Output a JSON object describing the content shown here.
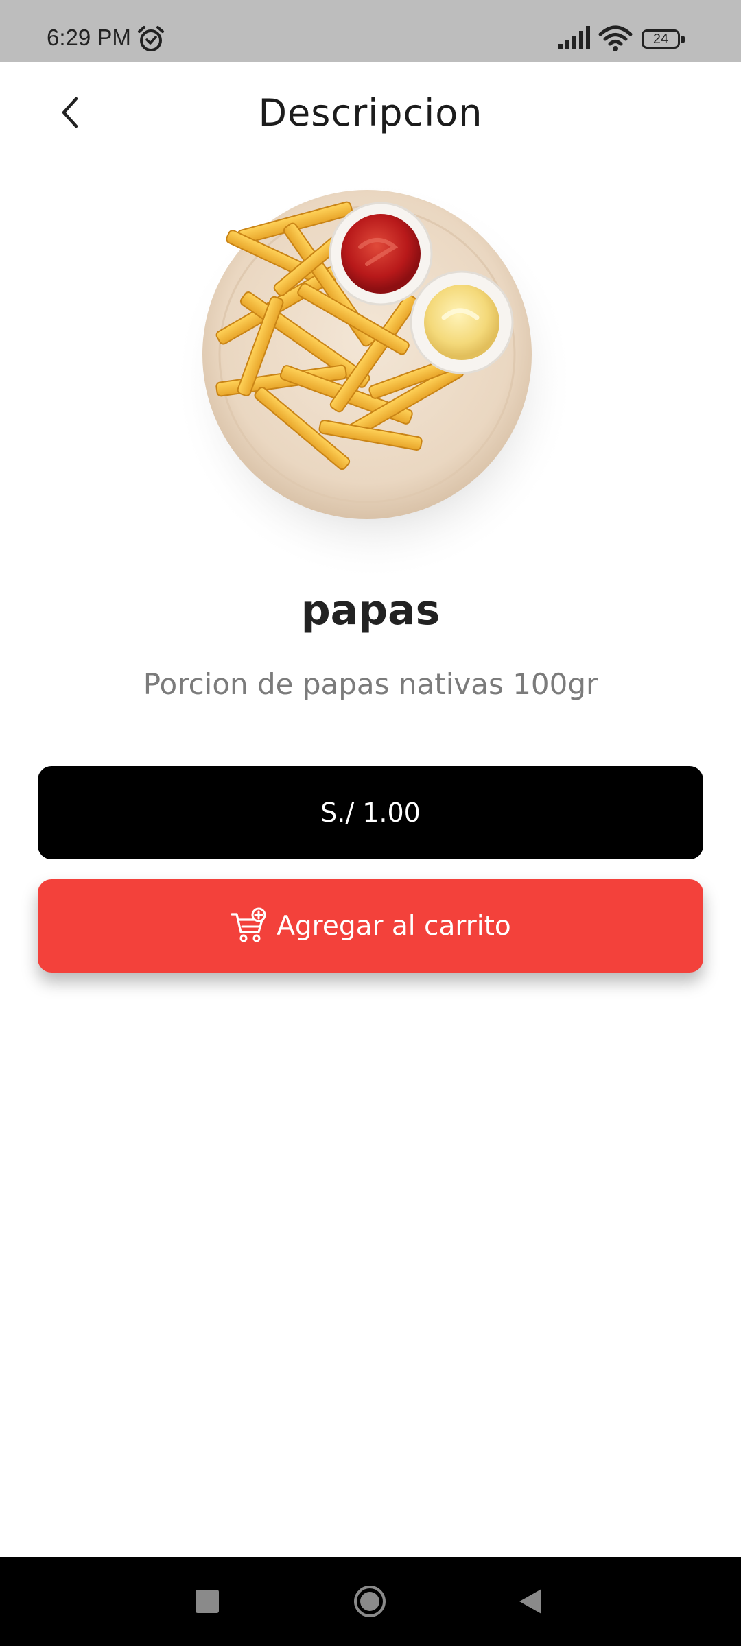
{
  "status_bar": {
    "time": "6:29 PM",
    "battery": "24",
    "icons": [
      "alarm-icon",
      "signal-icon",
      "wifi-icon",
      "battery-icon"
    ]
  },
  "header": {
    "title": "Descripcion",
    "back_icon": "chevron-left-icon"
  },
  "product": {
    "image_icon": "fries-plate-image",
    "name": "papas",
    "description": "Porcion de papas nativas 100gr",
    "price": "S./ 1.00"
  },
  "actions": {
    "add_to_cart_label": "Agregar al carrito",
    "add_to_cart_icon": "cart-plus-icon"
  },
  "colors": {
    "accent": "#f3413b",
    "price_bg": "#000000",
    "status_bar_bg": "#bdbdbd"
  },
  "nav_bar": {
    "icons": [
      "recents-icon",
      "home-icon",
      "back-icon"
    ]
  }
}
